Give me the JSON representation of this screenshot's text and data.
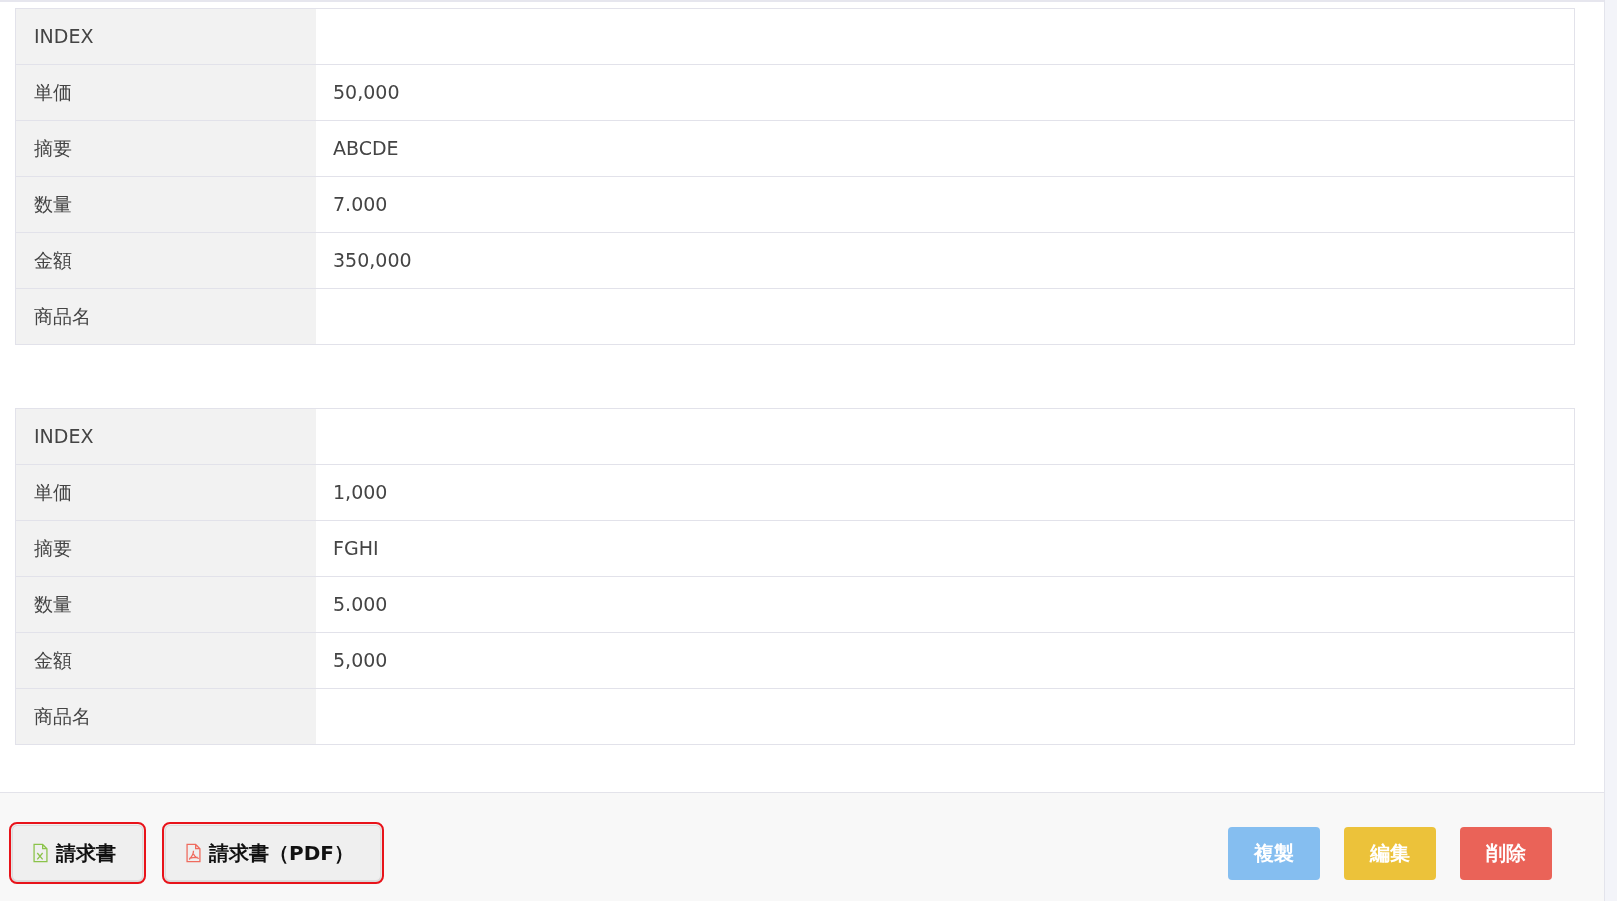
{
  "tables": [
    {
      "rows": [
        {
          "label": "INDEX",
          "value": ""
        },
        {
          "label": "単価",
          "value": "50,000"
        },
        {
          "label": "摘要",
          "value": "ABCDE"
        },
        {
          "label": "数量",
          "value": "7.000"
        },
        {
          "label": "金額",
          "value": "350,000"
        },
        {
          "label": "商品名",
          "value": ""
        }
      ]
    },
    {
      "rows": [
        {
          "label": "INDEX",
          "value": ""
        },
        {
          "label": "単価",
          "value": "1,000"
        },
        {
          "label": "摘要",
          "value": "FGHI"
        },
        {
          "label": "数量",
          "value": "5.000"
        },
        {
          "label": "金額",
          "value": "5,000"
        },
        {
          "label": "商品名",
          "value": ""
        }
      ]
    }
  ],
  "footer": {
    "left_buttons": [
      {
        "label": "請求書",
        "kind": "excel"
      },
      {
        "label": "請求書（PDF）",
        "kind": "pdf"
      }
    ],
    "right_buttons": [
      {
        "label": "複製",
        "color": "#85bef0"
      },
      {
        "label": "編集",
        "color": "#ecc23a"
      },
      {
        "label": "削除",
        "color": "#ea6358"
      }
    ]
  }
}
